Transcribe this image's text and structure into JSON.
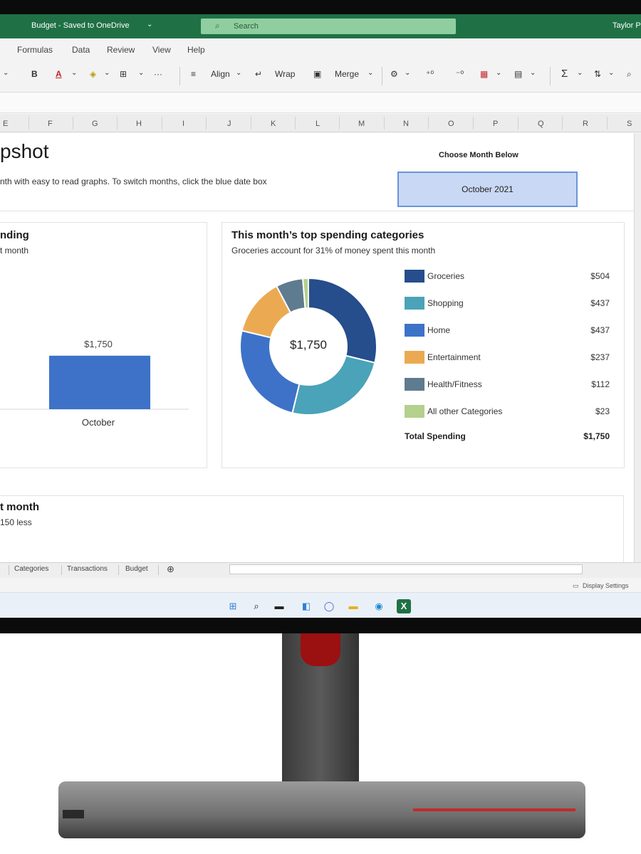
{
  "titlebar": {
    "doc_title": "Budget - Saved to OneDrive",
    "caret": "⌄",
    "search_placeholder": "Search",
    "user": "Taylor P"
  },
  "menu": [
    "Formulas",
    "Data",
    "Review",
    "View",
    "Help"
  ],
  "ribbon": {
    "bold": "B",
    "align": "Align",
    "wrap": "Wrap",
    "merge": "Merge",
    "more": "···",
    "sum": "Σ"
  },
  "columns": [
    "E",
    "F",
    "G",
    "H",
    "I",
    "J",
    "K",
    "L",
    "M",
    "N",
    "O",
    "P",
    "Q",
    "R",
    "S"
  ],
  "sheet": {
    "title": "pshot",
    "subtitle": "nth with easy to read graphs. To switch months, click the blue date box",
    "choose_label": "Choose Month Below",
    "selected_month": "October 2021"
  },
  "left_card": {
    "title": "nding",
    "subtitle": "t month",
    "bar_label": "$1,750",
    "category": "October"
  },
  "right_card": {
    "title": "This month’s top spending categories",
    "subtitle": "Groceries account for 31% of money spent this month",
    "center_label": "$1,750",
    "total_label": "Total Spending",
    "total_value": "$1,750"
  },
  "bottom_card": {
    "title": "t month",
    "subtitle": "150 less"
  },
  "chart_data": [
    {
      "type": "bar",
      "categories": [
        "October"
      ],
      "values": [
        1750
      ],
      "data_labels": [
        "$1,750"
      ],
      "color": "#3d72c8"
    },
    {
      "type": "pie",
      "title": "This month’s top spending categories",
      "subtitle": "Groceries account for 31% of money spent this month",
      "center_label": "$1,750",
      "categories": [
        "Groceries",
        "Shopping",
        "Home",
        "Entertainment",
        "Health/Fitness",
        "All other Categories"
      ],
      "values": [
        504,
        437,
        437,
        237,
        112,
        23
      ],
      "value_labels": [
        "$504",
        "$437",
        "$437",
        "$237",
        "$112",
        "$23"
      ],
      "colors": [
        "#264d8c",
        "#4aa3b8",
        "#3d72c8",
        "#ebaa52",
        "#5f7b8f",
        "#b3d08c"
      ]
    }
  ],
  "tabs": [
    "Categories",
    "Transactions",
    "Budget"
  ],
  "add_sheet": "⊕",
  "status": {
    "display_settings": "Display Settings"
  },
  "taskbar_icons": [
    "windows-icon",
    "search-icon",
    "task-view-icon",
    "widgets-icon",
    "chat-icon",
    "file-explorer-icon",
    "edge-icon",
    "excel-icon"
  ]
}
